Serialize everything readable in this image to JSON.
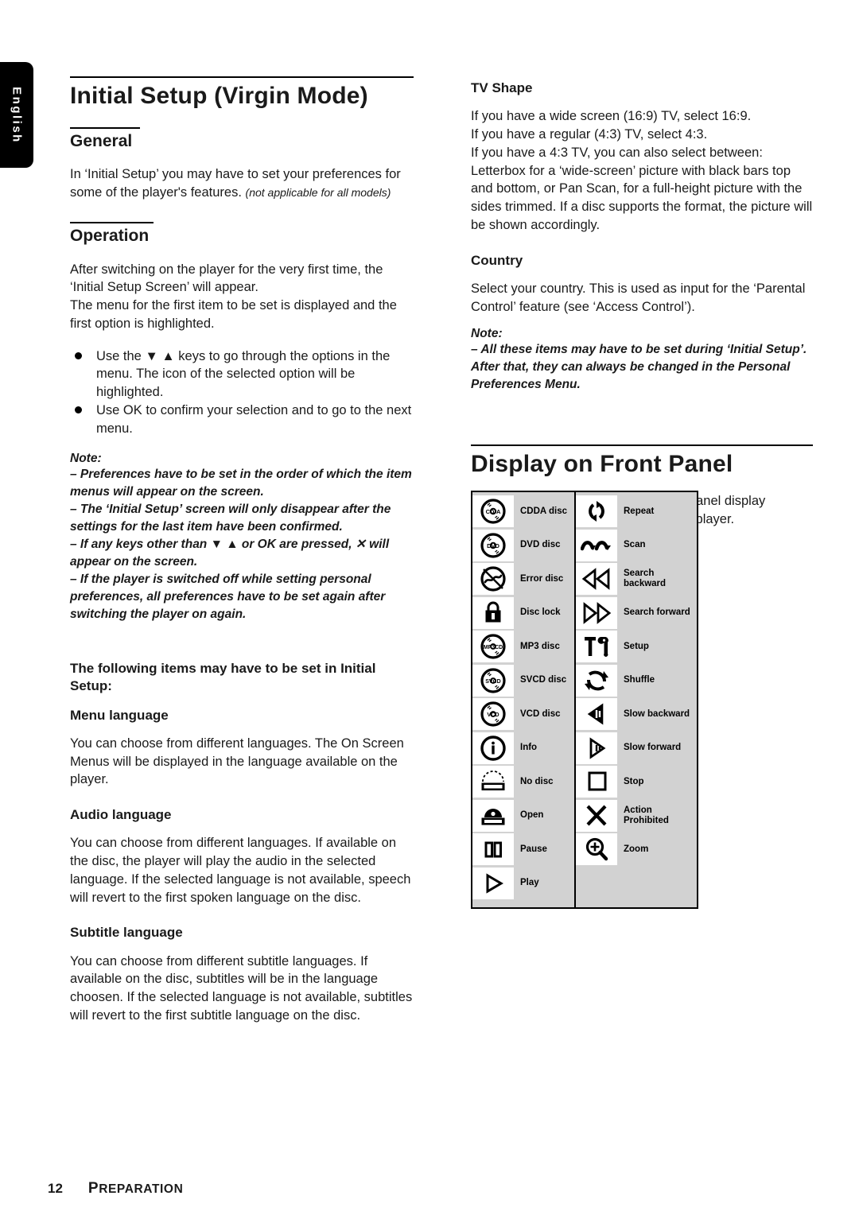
{
  "language_tab": {
    "label": "English"
  },
  "left_column": {
    "title": "Initial Setup (Virgin Mode)",
    "general": {
      "heading": "General",
      "paragraph": "In ‘Initial Setup’ you may have to set your preferences for some of the player's features.",
      "paragraph_italic_note": "(not applicable for all models)"
    },
    "operation": {
      "heading": "Operation",
      "paragraph1": "After switching on the player for the very first time, the ‘Initial Setup Screen’ will appear.",
      "paragraph2": "The menu for the first item to be set is displayed and the first option is highlighted.",
      "bullets": [
        "Use the ▼ ▲ keys to go through the options in the menu. The icon of the selected option will be highlighted.",
        "Use OK to confirm your selection and to go to the next menu."
      ],
      "note_label": "Note:",
      "notes": [
        "–   Preferences have to be set in the order of which the item menus will appear on the screen.",
        "–   The ‘Initial Setup’ screen will only disappear after the settings for the last item have been confirmed.",
        "–   If any keys other than ▼ ▲ or OK are pressed, ✕ will appear on the screen.",
        "–   If the player is switched off while setting personal preferences, all preferences have to be set again after switching the player on again."
      ]
    },
    "items_intro": "The following items may have to be set in Initial Setup:",
    "items": [
      {
        "heading": "Menu language",
        "text": "You can choose from different languages. The On Screen Menus will be displayed in the language available on the player."
      },
      {
        "heading": "Audio language",
        "text": "You can choose from different languages. If available on the disc, the player will play the audio in the selected language. If the selected language is not available, speech will revert to the first spoken language on the disc."
      },
      {
        "heading": "Subtitle language",
        "text": "You can choose from different subtitle languages. If available on the disc, subtitles will be in the language choosen. If the selected language is not available, subtitles will revert to the first subtitle language on the disc."
      }
    ]
  },
  "right_column": {
    "tv_shape": {
      "heading": "TV Shape",
      "lines": [
        "If you have a wide screen (16:9) TV, select 16:9.",
        "If you have a regular (4:3) TV, select 4:3.",
        "If you have a 4:3 TV, you can also select between:",
        "Letterbox for a ‘wide-screen’ picture with black bars top and bottom, or Pan Scan, for a full-height picture with the sides trimmed. If a disc supports the format, the picture will be shown accordingly."
      ]
    },
    "country": {
      "heading": "Country",
      "text": "Select your country. This is used as input for the ‘Parental Control’ feature (see ‘Access Control’).",
      "note_label": "Note:",
      "note": "–   All these items may have to be set during ‘Initial Setup’. After that, they can always be changed in the Personal Preferences Menu."
    },
    "front_panel": {
      "title": "Display on Front Panel",
      "intro": "Various icons will appear on the front panel display depending on the current status of the player."
    },
    "icon_table": {
      "left_items": [
        {
          "icon": "cdda-disc-icon",
          "label": "CDDA disc"
        },
        {
          "icon": "dvd-disc-icon",
          "label": "DVD disc"
        },
        {
          "icon": "error-disc-icon",
          "label": "Error disc"
        },
        {
          "icon": "disc-lock-icon",
          "label": "Disc lock"
        },
        {
          "icon": "mp3-disc-icon",
          "label": "MP3 disc"
        },
        {
          "icon": "svcd-disc-icon",
          "label": "SVCD disc"
        },
        {
          "icon": "vcd-disc-icon",
          "label": "VCD disc"
        },
        {
          "icon": "info-icon",
          "label": "Info"
        },
        {
          "icon": "no-disc-icon",
          "label": "No disc"
        },
        {
          "icon": "open-tray-icon",
          "label": "Open"
        },
        {
          "icon": "pause-icon",
          "label": "Pause"
        },
        {
          "icon": "play-icon",
          "label": "Play"
        }
      ],
      "right_items": [
        {
          "icon": "repeat-icon",
          "label": "Repeat"
        },
        {
          "icon": "scan-icon",
          "label": "Scan"
        },
        {
          "icon": "search-backward-icon",
          "label": "Search backward"
        },
        {
          "icon": "search-forward-icon",
          "label": "Search forward"
        },
        {
          "icon": "setup-icon",
          "label": "Setup"
        },
        {
          "icon": "shuffle-icon",
          "label": "Shuffle"
        },
        {
          "icon": "slow-backward-icon",
          "label": "Slow backward"
        },
        {
          "icon": "slow-forward-icon",
          "label": "Slow forward"
        },
        {
          "icon": "stop-icon",
          "label": "Stop"
        },
        {
          "icon": "action-prohibited-icon",
          "label": "Action\nProhibited"
        },
        {
          "icon": "zoom-icon",
          "label": "Zoom"
        }
      ]
    }
  },
  "footer": {
    "page_number": "12",
    "chapter_first": "P",
    "chapter_rest": "REPARATION"
  }
}
